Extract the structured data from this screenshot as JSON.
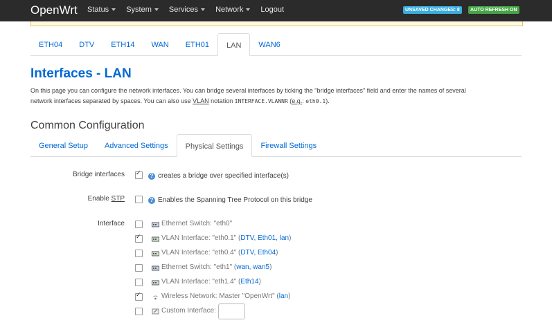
{
  "brand": "OpenWrt",
  "nav": [
    {
      "label": "Status",
      "dropdown": true
    },
    {
      "label": "System",
      "dropdown": true
    },
    {
      "label": "Services",
      "dropdown": true
    },
    {
      "label": "Network",
      "dropdown": true
    },
    {
      "label": "Logout",
      "dropdown": false
    }
  ],
  "badges": {
    "unsaved": "UNSAVED CHANGES: 8",
    "refresh": "AUTO REFRESH ON"
  },
  "iface_tabs": [
    "ETH04",
    "DTV",
    "ETH14",
    "WAN",
    "ETH01",
    "LAN",
    "WAN6"
  ],
  "active_iface_tab": "LAN",
  "page_title": "Interfaces - LAN",
  "description": {
    "line1": "On this page you can configure the network interfaces. You can bridge several interfaces by ticking the \"bridge interfaces\" field and enter the names of several",
    "line2_a": "network interfaces separated by spaces. You can also use ",
    "line2_vlan": "VLAN",
    "line2_b": " notation ",
    "line2_code": "INTERFACE.VLANNR",
    "line2_c": " (",
    "line2_eg": "e.g.",
    "line2_d": ": ",
    "line2_code2": "eth0.1",
    "line2_e": ")."
  },
  "section_title": "Common Configuration",
  "config_tabs": [
    "General Setup",
    "Advanced Settings",
    "Physical Settings",
    "Firewall Settings"
  ],
  "active_config_tab": "Physical Settings",
  "fields": {
    "bridge": {
      "label": "Bridge interfaces",
      "checked": true,
      "help": "creates a bridge over specified interface(s)"
    },
    "stp": {
      "label_pre": "Enable ",
      "label_abbr": "STP",
      "checked": false,
      "help": "Enables the Spanning Tree Protocol on this bridge"
    },
    "interface": {
      "label": "Interface"
    }
  },
  "interfaces": [
    {
      "text": "Ethernet Switch: \"eth0\"",
      "links": "",
      "checked": false,
      "icon": "switch-icon"
    },
    {
      "text": "VLAN Interface: \"eth0.1\" (",
      "links": "DTV, Eth01, lan",
      "suffix": ")",
      "checked": true,
      "icon": "vlan-icon"
    },
    {
      "text": "VLAN Interface: \"eth0.4\" (",
      "links": "DTV, Eth04",
      "suffix": ")",
      "checked": false,
      "icon": "vlan-icon"
    },
    {
      "text": "Ethernet Switch: \"eth1\" (",
      "links": "wan, wan5",
      "suffix": ")",
      "checked": false,
      "icon": "switch-icon"
    },
    {
      "text": "VLAN Interface: \"eth1.4\" (",
      "links": "Eth14",
      "suffix": ")",
      "checked": false,
      "icon": "vlan-icon"
    },
    {
      "text": "Wireless Network: Master \"OpenWrt\" (",
      "links": "lan",
      "suffix": ")",
      "checked": true,
      "icon": "wireless-icon"
    },
    {
      "text": "Custom Interface:",
      "links": "",
      "checked": false,
      "icon": "custom-icon"
    }
  ]
}
